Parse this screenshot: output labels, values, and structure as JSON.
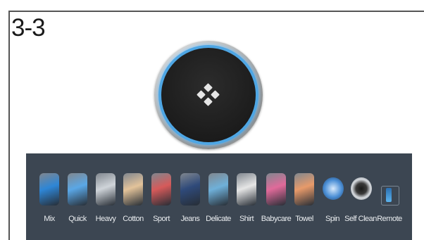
{
  "step": {
    "label": "3-3"
  },
  "dial": {
    "icon": "four-diamond-icon",
    "ring_color": "#4ea6e4"
  },
  "programs": [
    {
      "label": "Mix",
      "icon": "mixed-garment-icon",
      "color": "#2e86d6"
    },
    {
      "label": "Quick",
      "icon": "quick-wash-icon",
      "color": "#5aa7e6"
    },
    {
      "label": "Heavy",
      "icon": "heavy-stack-icon",
      "color": "#cfd4d9"
    },
    {
      "label": "Cotton",
      "icon": "cotton-shirt-icon",
      "color": "#e3c39a"
    },
    {
      "label": "Sport",
      "icon": "sport-jacket-icon",
      "color": "#d65a5a"
    },
    {
      "label": "Jeans",
      "icon": "jeans-icon",
      "color": "#2f4a7a"
    },
    {
      "label": "Delicate",
      "icon": "delicate-icon",
      "color": "#6fb0d9"
    },
    {
      "label": "Shirt",
      "icon": "shirt-icon",
      "color": "#e6e6e6"
    },
    {
      "label": "Babycare",
      "icon": "babycare-icon",
      "color": "#e06a9a"
    },
    {
      "label": "Towel",
      "icon": "towel-icon",
      "color": "#e79a6a"
    },
    {
      "label": "Spin",
      "icon": "spin-icon",
      "color": "#4b8fd6"
    },
    {
      "label": "Self Clean",
      "icon": "self-clean-icon",
      "color": "#9aa3ad"
    },
    {
      "label": "Remote",
      "icon": "remote-icon",
      "color": "#4ea6e4"
    }
  ]
}
